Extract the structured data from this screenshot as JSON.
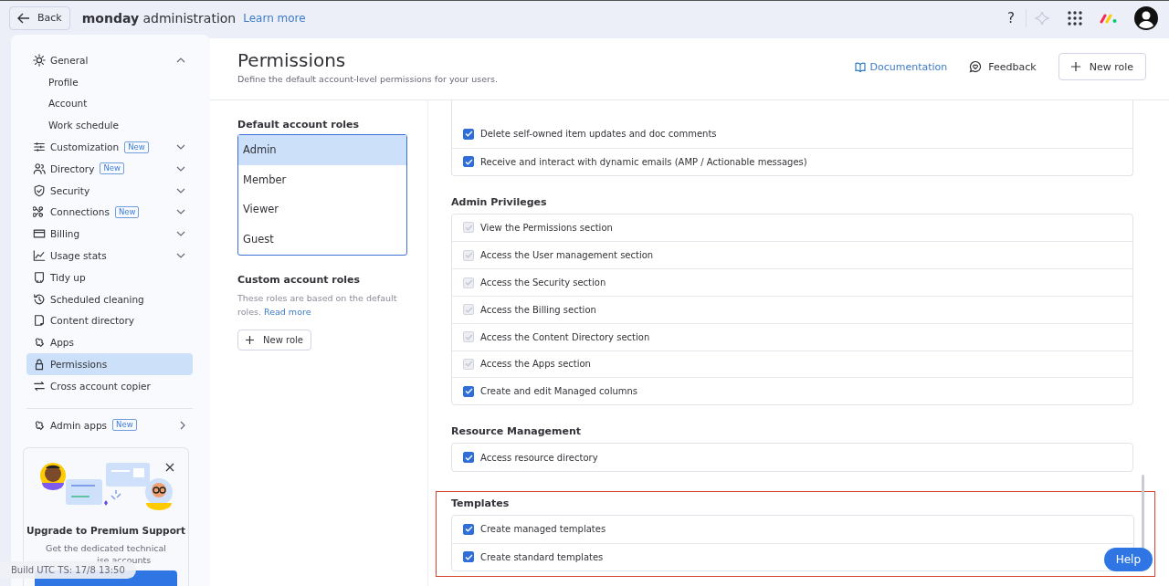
{
  "topbar": {
    "back": "Back",
    "brand_bold": "monday",
    "brand_rest": "administration",
    "learn_more": "Learn more",
    "help": "?"
  },
  "sidebar": {
    "items": [
      {
        "label": "General",
        "expanded": true,
        "selected": false,
        "children": [
          {
            "label": "Profile",
            "selected": false
          },
          {
            "label": "Account",
            "selected": false
          },
          {
            "label": "Work schedule",
            "selected": false
          }
        ]
      },
      {
        "label": "Customization",
        "badge": "New",
        "expanded": false,
        "selected": false
      },
      {
        "label": "Directory",
        "badge": "New",
        "expanded": false,
        "selected": false
      },
      {
        "label": "Security",
        "expanded": false,
        "selected": false
      },
      {
        "label": "Connections",
        "badge": "New",
        "expanded": false,
        "selected": false
      },
      {
        "label": "Billing",
        "expanded": false,
        "selected": false
      },
      {
        "label": "Usage stats",
        "expanded": false,
        "selected": false
      },
      {
        "label": "Tidy up",
        "selected": false
      },
      {
        "label": "Scheduled cleaning",
        "selected": false
      },
      {
        "label": "Content directory",
        "selected": false
      },
      {
        "label": "Apps",
        "selected": false
      },
      {
        "label": "Permissions",
        "selected": true
      },
      {
        "label": "Cross account copier",
        "selected": false
      }
    ],
    "admin_apps": {
      "label": "Admin apps",
      "badge": "New"
    },
    "promo": {
      "title": "Upgrade to Premium Support",
      "line_1": "Get the dedicated technical",
      "line_2_visible": "ise accounts"
    },
    "build_tag": "Build UTC TS: 17/8 13:50"
  },
  "header": {
    "title": "Permissions",
    "subtitle": "Define the default account-level permissions for your users.",
    "documentation": "Documentation",
    "feedback": "Feedback",
    "new_role": "New role"
  },
  "roles": {
    "default_title": "Default account roles",
    "default_roles": [
      {
        "label": "Admin",
        "selected": true
      },
      {
        "label": "Member",
        "selected": false
      },
      {
        "label": "Viewer",
        "selected": false
      },
      {
        "label": "Guest",
        "selected": false
      }
    ],
    "custom_title": "Custom account roles",
    "custom_text": "These roles are based on the default roles.",
    "read_more": "Read more",
    "new_role": "New role"
  },
  "sections": [
    {
      "highlighted": false,
      "rows": [
        {
          "label": "Delete self-owned item updates and doc comments",
          "checked": true,
          "disabled": false
        },
        {
          "label": "Receive and interact with dynamic emails (AMP / Actionable messages)",
          "checked": true,
          "disabled": false
        }
      ]
    },
    {
      "title": "Admin Privileges",
      "highlighted": false,
      "rows": [
        {
          "label": "View the Permissions section",
          "checked": true,
          "disabled": true
        },
        {
          "label": "Access the User management section",
          "checked": true,
          "disabled": true
        },
        {
          "label": "Access the Security section",
          "checked": true,
          "disabled": true
        },
        {
          "label": "Access the Billing section",
          "checked": true,
          "disabled": true
        },
        {
          "label": "Access the Content Directory section",
          "checked": true,
          "disabled": true
        },
        {
          "label": "Access the Apps section",
          "checked": true,
          "disabled": true
        },
        {
          "label": "Create and edit Managed columns",
          "checked": true,
          "disabled": false
        }
      ]
    },
    {
      "title": "Resource Management",
      "highlighted": false,
      "rows": [
        {
          "label": "Access resource directory",
          "checked": true,
          "disabled": false
        }
      ]
    },
    {
      "title": "Templates",
      "highlighted": true,
      "rows": [
        {
          "label": "Create managed templates",
          "checked": true,
          "disabled": false
        },
        {
          "label": "Create standard templates",
          "checked": true,
          "disabled": false
        }
      ]
    }
  ],
  "help_button": "Help"
}
